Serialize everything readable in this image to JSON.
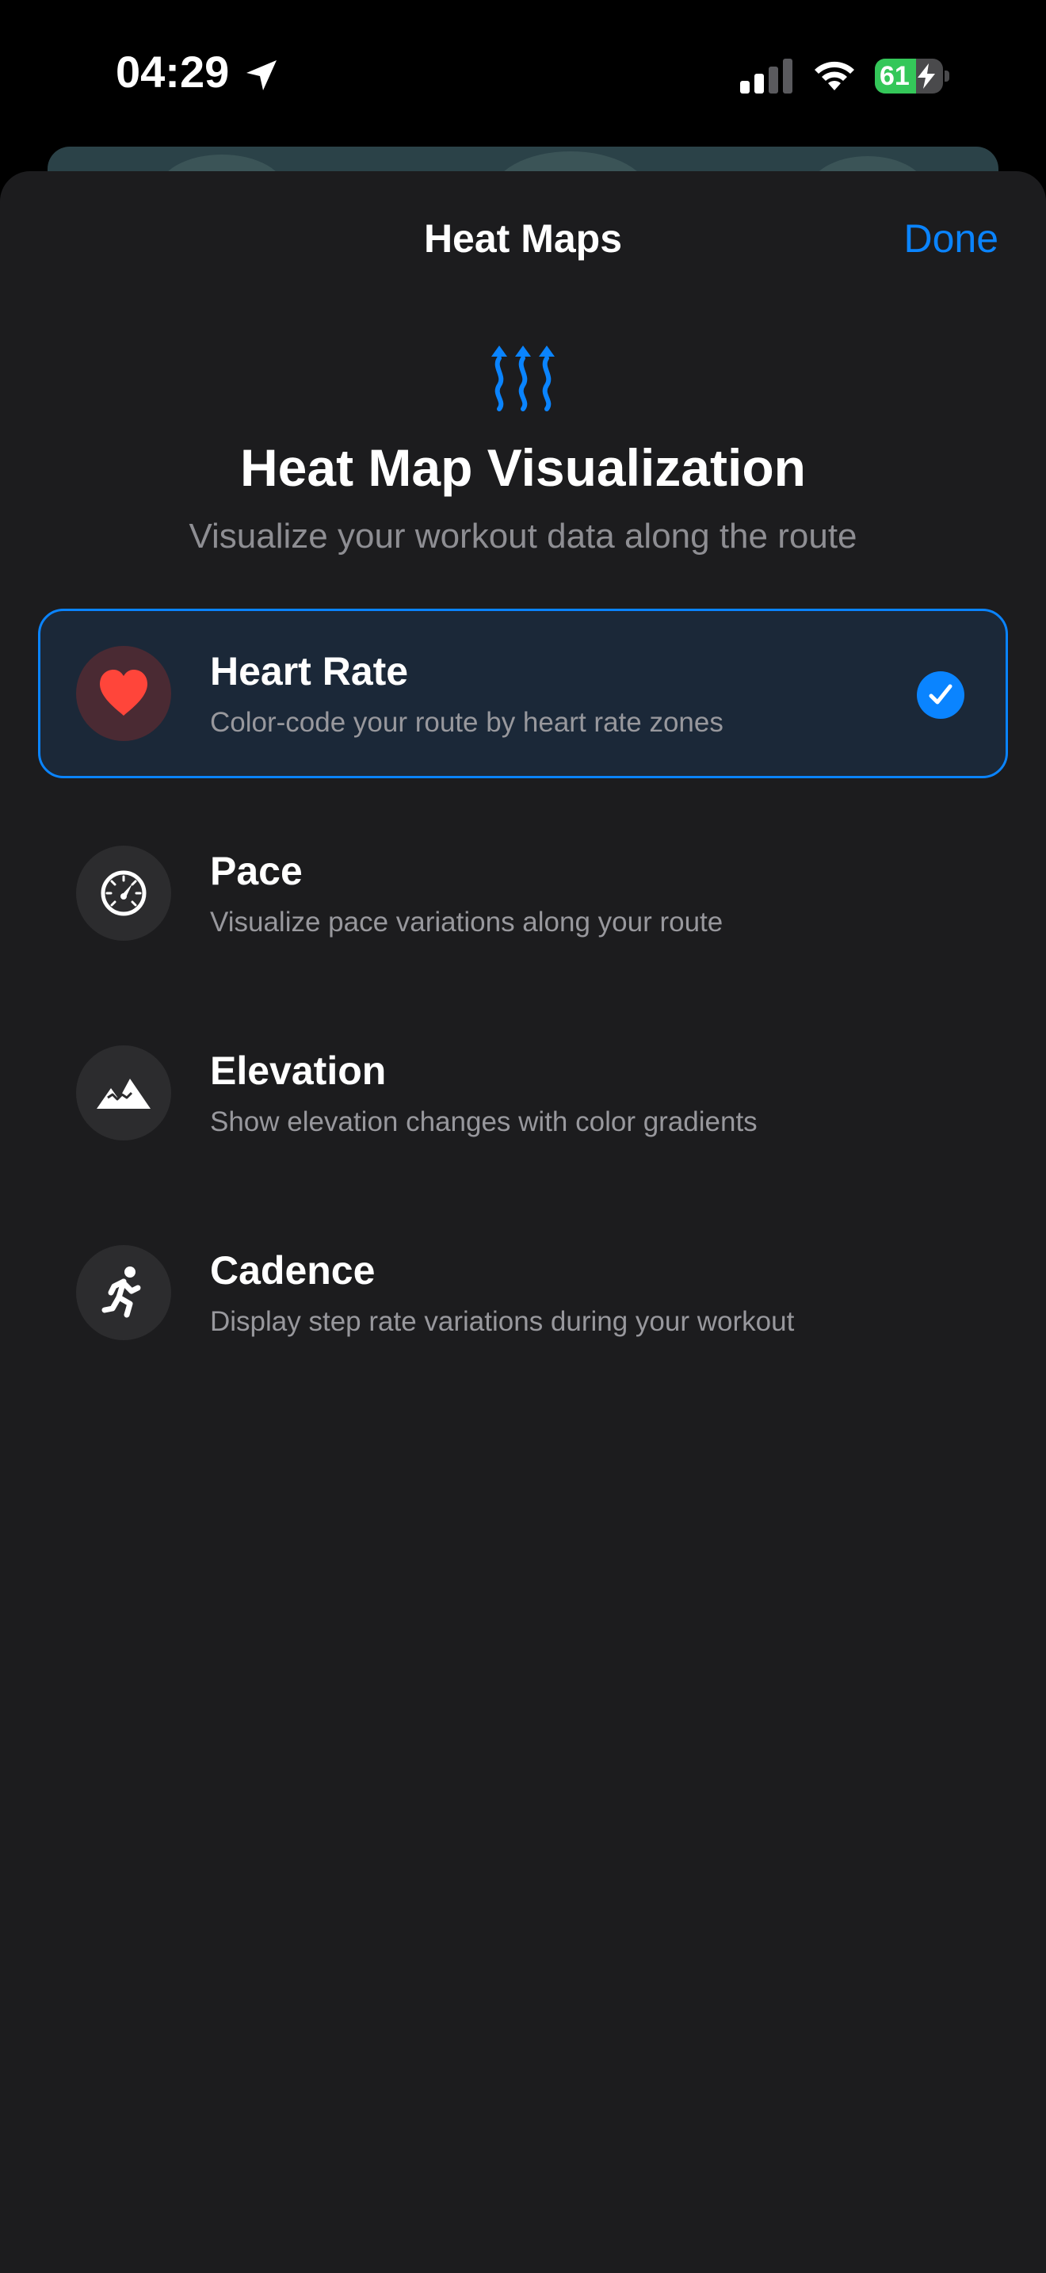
{
  "status_bar": {
    "time": "04:29",
    "battery_percent": "61",
    "battery_level": 0.61,
    "location_icon": "location-arrow-icon",
    "signal_icon": "cellular-signal-icon",
    "wifi_icon": "wifi-icon",
    "charging_icon": "bolt-icon"
  },
  "sheet": {
    "title": "Heat Maps",
    "done_label": "Done",
    "header_icon": "heat-waves-icon",
    "headline": "Heat Map Visualization",
    "subheadline": "Visualize your workout data along the route"
  },
  "options": [
    {
      "title": "Heart Rate",
      "description": "Color-code your route by heart rate zones",
      "icon": "heart-icon",
      "selected": true
    },
    {
      "title": "Pace",
      "description": "Visualize pace variations along your route",
      "icon": "speedometer-icon",
      "selected": false
    },
    {
      "title": "Elevation",
      "description": "Show elevation changes with color gradients",
      "icon": "mountains-icon",
      "selected": false
    },
    {
      "title": "Cadence",
      "description": "Display step rate variations during your workout",
      "icon": "running-figure-icon",
      "selected": false
    }
  ],
  "colors": {
    "accent": "#0a84ff",
    "sheet_background": "#1c1c1e",
    "selected_background": "#1b2838",
    "heart_red": "#ff453a",
    "battery_green": "#34c759"
  }
}
